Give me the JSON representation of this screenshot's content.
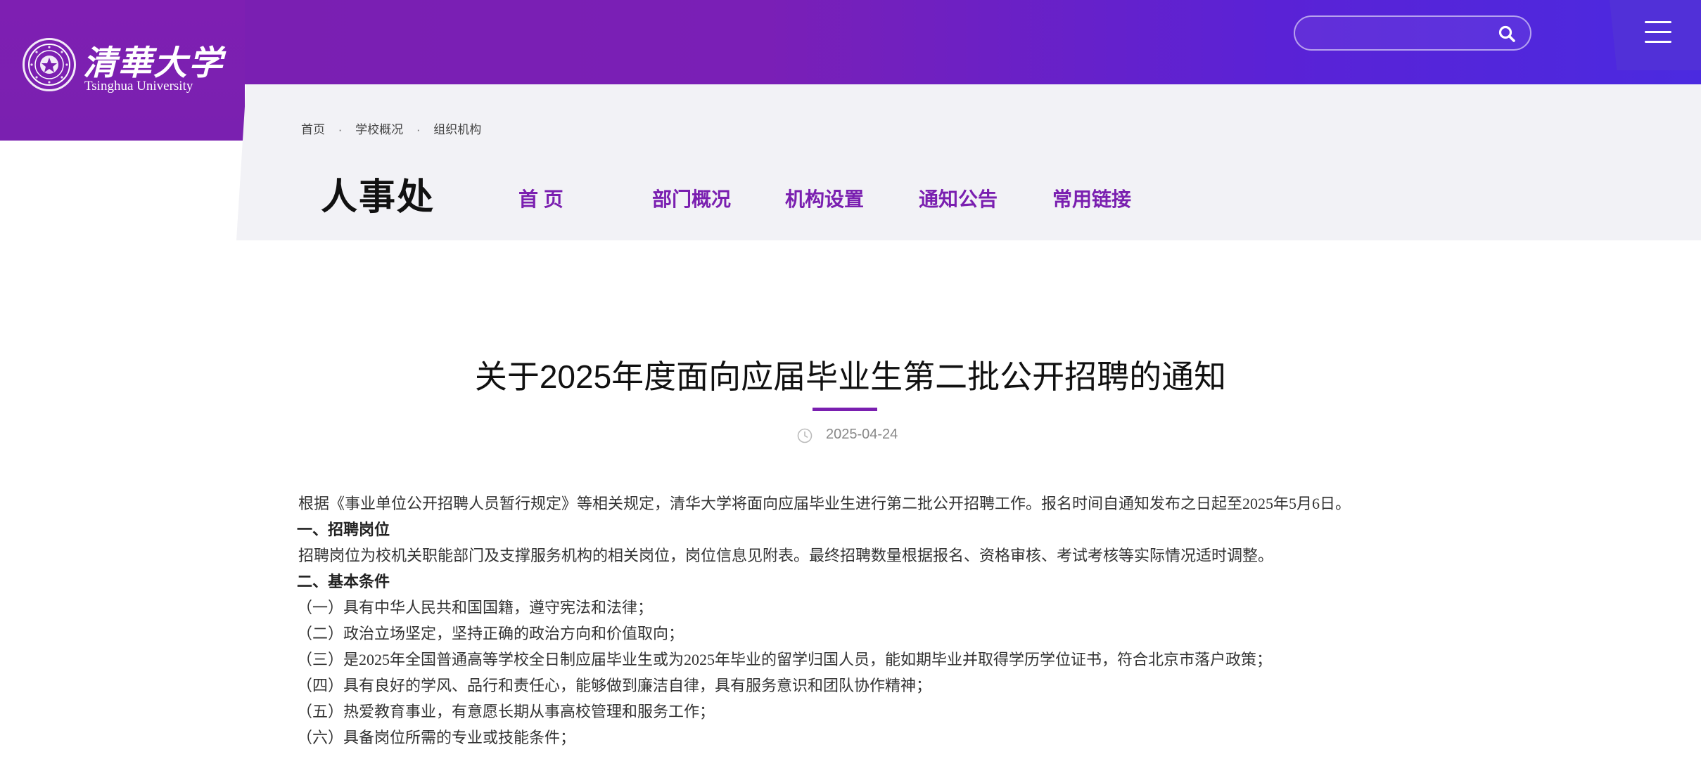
{
  "header": {
    "logo_cn": "清華大学",
    "logo_en": "Tsinghua University",
    "logo_icon": "tsinghua-seal-icon",
    "search": {
      "placeholder": "",
      "value": "",
      "icon": "search-icon"
    },
    "menu_icon": "hamburger-menu-icon"
  },
  "breadcrumb": [
    "首页",
    "学校概况",
    "组织机构"
  ],
  "breadcrumb_sep": "·",
  "department": {
    "title": "人事处"
  },
  "nav": [
    "首 页",
    "部门概况",
    "机构设置",
    "通知公告",
    "常用链接"
  ],
  "article": {
    "title": "关于2025年度面向应届毕业生第二批公开招聘的通知",
    "date": "2025-04-24",
    "date_icon": "clock-icon",
    "paragraphs": [
      {
        "type": "indent",
        "text": "根据《事业单位公开招聘人员暂行规定》等相关规定，清华大学将面向应届毕业生进行第二批公开招聘工作。报名时间自通知发布之日起至2025年5月6日。"
      },
      {
        "type": "heading",
        "text": "一、招聘岗位"
      },
      {
        "type": "indent",
        "text": "招聘岗位为校机关职能部门及支撑服务机构的相关岗位，岗位信息见附表。最终招聘数量根据报名、资格审核、考试考核等实际情况适时调整。"
      },
      {
        "type": "heading",
        "text": "二、基本条件"
      },
      {
        "type": "item",
        "text": "（一）具有中华人民共和国国籍，遵守宪法和法律；"
      },
      {
        "type": "item",
        "text": "（二）政治立场坚定，坚持正确的政治方向和价值取向；"
      },
      {
        "type": "item",
        "text": "（三）是2025年全国普通高等学校全日制应届毕业生或为2025年毕业的留学归国人员，能如期毕业并取得学历学位证书，符合北京市落户政策；"
      },
      {
        "type": "item",
        "text": "（四）具有良好的学风、品行和责任心，能够做到廉洁自律，具有服务意识和团队协作精神；"
      },
      {
        "type": "item",
        "text": "（五）热爱教育事业，有意愿长期从事高校管理和服务工作；"
      },
      {
        "type": "item",
        "text": "（六）具备岗位所需的专业或技能条件；"
      }
    ]
  },
  "colors": {
    "brand_purple": "#7a1fb0",
    "header_blue": "#4b2ae0",
    "nav_panel_bg": "#f2f2f6"
  }
}
